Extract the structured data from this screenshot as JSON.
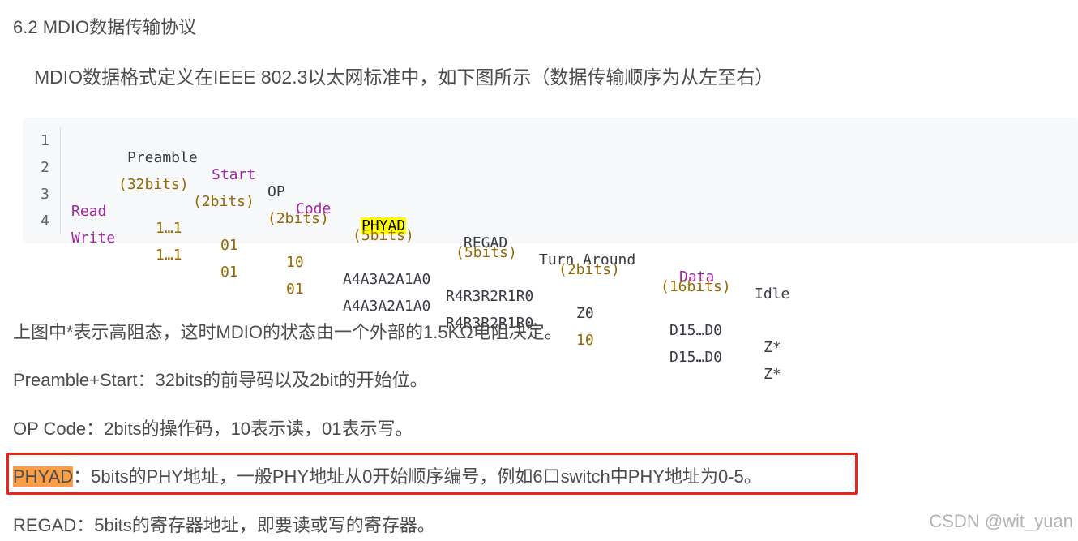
{
  "heading": "6.2 MDIO数据传输协议",
  "intro": "MDIO数据格式定义在IEEE 802.3以太网标准中，如下图所示（数据传输顺序为从左至右）",
  "code": {
    "line_numbers": [
      "1",
      "2",
      "3",
      "4"
    ],
    "header": {
      "preamble": "Preamble",
      "start": "Start",
      "op": "OP",
      "code": "Code",
      "phyad": "PHYAD",
      "regad": "REGAD",
      "turn": "Turn Around",
      "data": "Data",
      "idle": "Idle"
    },
    "bits": [
      "(32bits)",
      "(2bits)",
      "(2bits)",
      "(5bits)",
      "(5bits)",
      "(2bits)",
      "(16bits)"
    ],
    "rows": [
      {
        "name": "Read",
        "preamble": "1…1",
        "start": "01",
        "op": "10",
        "phyad": "A4A3A2A1A0",
        "regad": "R4R3R2R1R0",
        "ta": "Z0",
        "data": "D15…D0",
        "idle": "Z*"
      },
      {
        "name": "Write",
        "preamble": "1…1",
        "start": "01",
        "op": "01",
        "phyad": "A4A3A2A1A0",
        "regad": "R4R3R2R1R0",
        "ta": "10",
        "data": "D15…D0",
        "idle": "Z*"
      }
    ]
  },
  "notes": {
    "hiz": "上图中*表示高阻态，这时MDIO的状态由一个外部的1.5KΩ电阻决定。",
    "preamble": "Preamble+Start：32bits的前导码以及2bit的开始位。",
    "opcode": "OP Code：2bits的操作码，10表示读，01表示写。",
    "phyad_term": "PHYAD",
    "phyad_desc": "：5bits的PHY地址，一般PHY地址从0开始顺序编号，例如6口switch中PHY地址为0-5。",
    "regad": "REGAD：5bits的寄存器地址，即要读或写的寄存器。"
  },
  "watermark": "CSDN @wit_yuan",
  "colors": {
    "keyword": "#a626a4",
    "number": "#986801",
    "highlight_yellow": "#ffff00",
    "highlight_orange": "#fb9d43",
    "redbox": "#e8261e"
  }
}
